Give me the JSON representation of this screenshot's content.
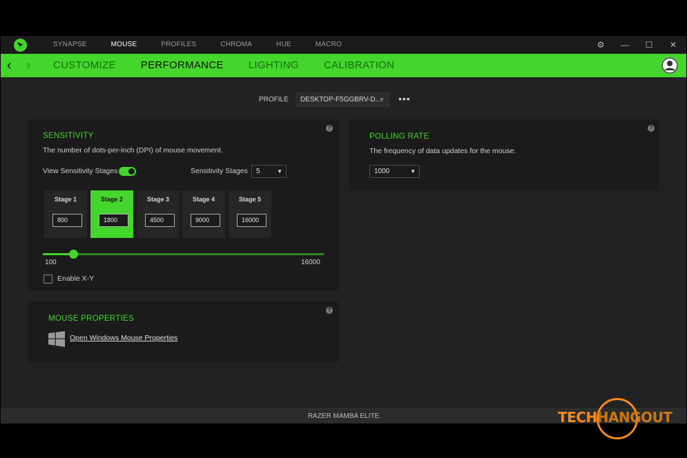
{
  "window": {
    "top_nav": [
      "SYNAPSE",
      "MOUSE",
      "PROFILES",
      "CHROMA",
      "HUE",
      "MACRO"
    ],
    "active_top": "MOUSE",
    "sub_tabs": [
      "CUSTOMIZE",
      "PERFORMANCE",
      "LIGHTING",
      "CALIBRATION"
    ],
    "active_sub": "PERFORMANCE",
    "controls": {
      "settings": "⚙",
      "minimize": "—",
      "maximize": "☐",
      "close": "✕"
    },
    "back": "‹",
    "forward": "›"
  },
  "profile": {
    "label": "PROFILE",
    "value": "DESKTOP-F5GGBRV-D...",
    "more": "•••"
  },
  "sensitivity": {
    "title": "SENSITIVITY",
    "description": "The number of dots-per-inch (DPI) of mouse movement.",
    "view_stages_label": "View Sensitivity Stages",
    "view_stages_on": true,
    "stages_label": "Sensitivity Stages",
    "stages_value": "5",
    "stages": [
      {
        "label": "Stage 1",
        "value": "800"
      },
      {
        "label": "Stage 2",
        "value": "1800"
      },
      {
        "label": "Stage 3",
        "value": "4500"
      },
      {
        "label": "Stage 4",
        "value": "9000"
      },
      {
        "label": "Stage 5",
        "value": "16000"
      }
    ],
    "active_stage": 1,
    "slider": {
      "min": "100",
      "max": "16000",
      "value": 1800
    },
    "enable_xy_label": "Enable X-Y",
    "enable_xy_checked": false
  },
  "polling": {
    "title": "POLLING RATE",
    "description": "The frequency of data updates for the mouse.",
    "value": "1000"
  },
  "mouse_properties": {
    "title": "MOUSE PROPERTIES",
    "link": "Open Windows Mouse Properties"
  },
  "status": {
    "device": "RAZER MAMBA ELITE"
  },
  "watermark": {
    "part1": "TECH",
    "part2": "HANGOUT"
  },
  "help_glyph": "?",
  "caret": "▼",
  "colors": {
    "accent": "#44d62c",
    "panel": "#1b1b1b",
    "background": "#222222",
    "watermark": "#f58a1f"
  }
}
